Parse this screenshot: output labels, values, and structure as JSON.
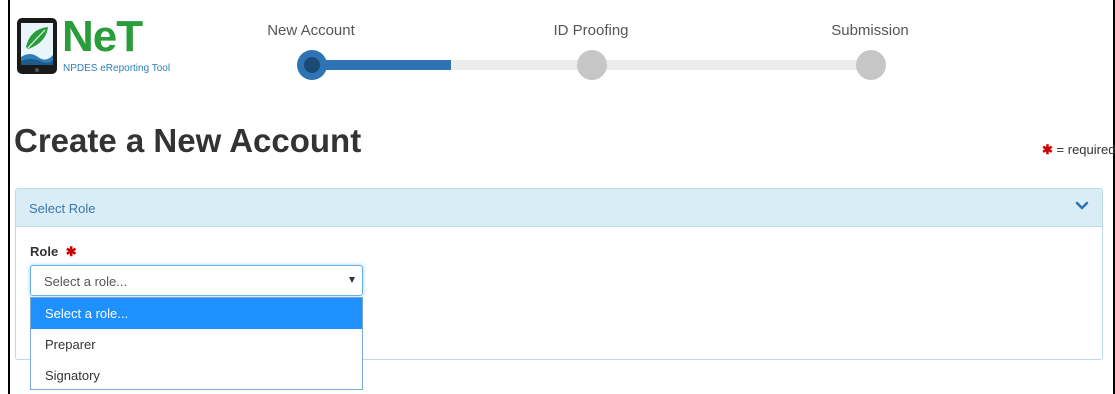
{
  "logo": {
    "name": "NeT",
    "subtitle": "NPDES eReporting Tool"
  },
  "steps": [
    {
      "label": "New Account",
      "status": "active"
    },
    {
      "label": "ID Proofing",
      "status": "pending"
    },
    {
      "label": "Submission",
      "status": "pending"
    }
  ],
  "page": {
    "title": "Create a New Account",
    "required_marker": "✱",
    "required_text": "= required"
  },
  "panel": {
    "title": "Select Role",
    "chevron_icon": "chevron-down-icon"
  },
  "role_field": {
    "label": "Role",
    "required_marker": "✱",
    "selected_value": "Select a role...",
    "options": [
      "Select a role...",
      "Preparer",
      "Signatory"
    ]
  },
  "colors": {
    "accent": "#2e74b5",
    "brand_green": "#2a9d3b",
    "panel_heading": "#d9edf7",
    "option_highlight": "#1e90ff",
    "required": "#cc0000"
  }
}
